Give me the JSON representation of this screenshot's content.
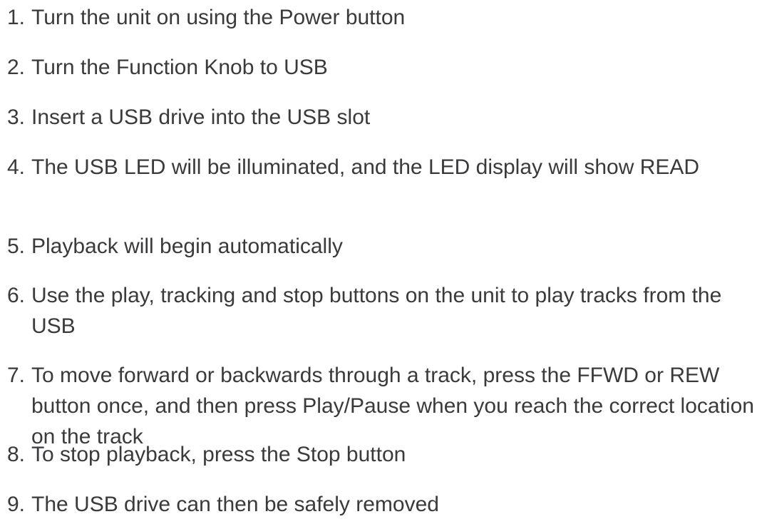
{
  "steps": [
    {
      "number": "1.",
      "text": "Turn the unit on using the Power button"
    },
    {
      "number": "2.",
      "text": "Turn the Function Knob to USB"
    },
    {
      "number": "3.",
      "text": "Insert a USB drive into the USB slot"
    },
    {
      "number": "4.",
      "text": "The USB LED will be illuminated, and the LED display will show READ"
    },
    {
      "number": "5.",
      "text": "Playback will begin automatically"
    },
    {
      "number": "6.",
      "text": "Use the play, tracking and stop buttons on the unit to play tracks from the USB"
    },
    {
      "number": "7.",
      "text": "To move forward or backwards through a track, press the FFWD or REW button once, and then press Play/Pause when you reach the correct location on the track"
    },
    {
      "number": "8.",
      "text": "To stop playback, press the Stop button"
    },
    {
      "number": "9.",
      "text": "The USB drive can then be safely removed"
    }
  ]
}
